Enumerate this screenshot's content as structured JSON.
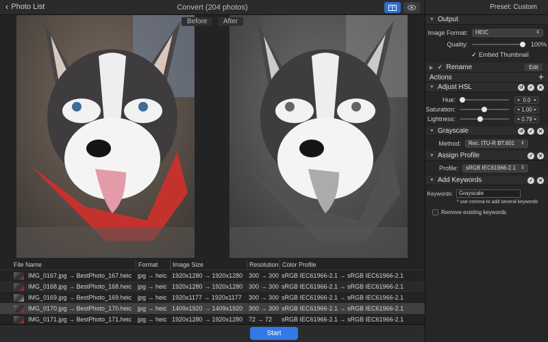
{
  "topbar": {
    "back_label": "Photo List",
    "title": "Convert (204 photos)",
    "view_buttons": [
      "split-view-icon",
      "eye-icon"
    ]
  },
  "preview": {
    "before_label": "Before",
    "after_label": "After"
  },
  "table": {
    "headers": [
      "File Name",
      "Format",
      "Image Size",
      "Resolution",
      "Color Profile"
    ],
    "rows": [
      {
        "name": "IMG_0167.jpg → BestPhoto_167.heic",
        "format": "jpg → heic",
        "size": "1920x1280 → 1920x1280",
        "res": "300 → 300",
        "profile": "sRGB IEC61966-2.1 → sRGB IEC61966-2.1"
      },
      {
        "name": "IMG_0168.jpg → BestPhoto_168.heic",
        "format": "jpg → heic",
        "size": "1920x1280 → 1920x1280",
        "res": "300 → 300",
        "profile": "sRGB IEC61966-2.1 → sRGB IEC61966-2.1"
      },
      {
        "name": "IMG_0169.jpg → BestPhoto_169.heic",
        "format": "jpg → heic",
        "size": "1920x1177 → 1920x1177",
        "res": "300 → 300",
        "profile": "sRGB IEC61966-2.1 → sRGB IEC61966-2.1"
      },
      {
        "name": "IMG_0170.jpg → BestPhoto_170.heic",
        "format": "jpg → heic",
        "size": "1409x1920 → 1409x1920",
        "res": "300 → 300",
        "profile": "sRGB IEC61966-2.1 → sRGB IEC61966-2.1"
      },
      {
        "name": "IMG_0171.jpg → BestPhoto_171.heic",
        "format": "jpg → heic",
        "size": "1920x1280 → 1920x1280",
        "res": "72 → 72",
        "profile": "sRGB IEC61966-2.1 → sRGB IEC61966-2.1"
      }
    ]
  },
  "start_label": "Start",
  "sidebar": {
    "preset": "Preset: Custom",
    "output": {
      "title": "Output",
      "format_label": "Image Format:",
      "format_value": "HEIC",
      "quality_label": "Quality:",
      "quality_value": "100%",
      "quality_level": 1.0,
      "embed_label": "Embed Thumbnail"
    },
    "rename": {
      "label": "Rename",
      "edit_label": "Edit"
    },
    "actions_label": "Actions",
    "hsl": {
      "title": "Adjust HSL",
      "hue_label": "Hue:",
      "hue_value": "0.0",
      "hue_level": 0.0,
      "sat_label": "Saturation:",
      "sat_value": "1.00",
      "sat_level": 0.5,
      "light_label": "Lightness:",
      "light_value": "0.79",
      "light_level": 0.4
    },
    "grayscale": {
      "title": "Grayscale",
      "method_label": "Method:",
      "method_value": "Rec. ITU-R BT.601"
    },
    "profile": {
      "title": "Assign Profile",
      "profile_label": "Profile:",
      "profile_value": "sRGB IEC61966-2.1"
    },
    "keywords": {
      "title": "Add Keywords",
      "keywords_label": "Keywords:",
      "keywords_value": "Grayscale",
      "hint": "* use comma to add several keywords",
      "remove_label": "Remove existing keywords"
    }
  }
}
